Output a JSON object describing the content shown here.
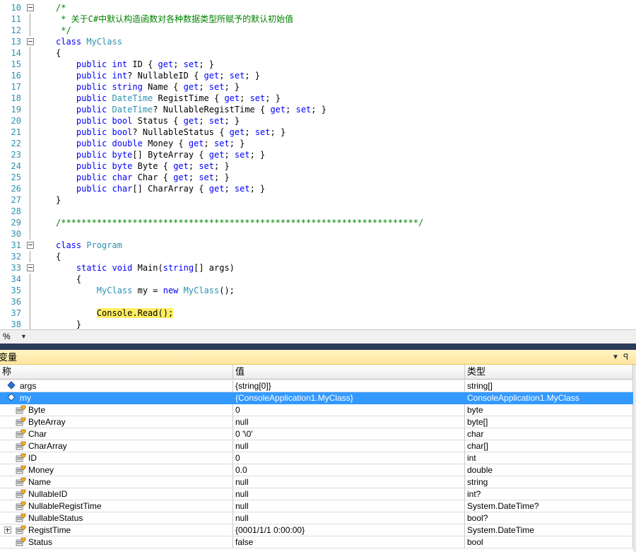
{
  "editor": {
    "lines": [
      {
        "num": "10",
        "fold": "collapse",
        "tokens": [
          {
            "t": "/*",
            "c": "cm"
          }
        ]
      },
      {
        "num": "11",
        "fold": "line",
        "tokens": [
          {
            "t": " * 关于C#中默认构造函数对各种数据类型所赋予的默认初始值",
            "c": "cm"
          }
        ]
      },
      {
        "num": "12",
        "fold": "line",
        "tokens": [
          {
            "t": " */",
            "c": "cm"
          }
        ]
      },
      {
        "num": "13",
        "fold": "collapse",
        "tokens": [
          {
            "t": "class ",
            "c": "kw"
          },
          {
            "t": "MyClass",
            "c": "ty"
          }
        ]
      },
      {
        "num": "14",
        "fold": "line",
        "tokens": [
          {
            "t": "{",
            "c": ""
          }
        ]
      },
      {
        "num": "15",
        "fold": "line",
        "tokens": [
          {
            "t": "    ",
            "c": ""
          },
          {
            "t": "public int ",
            "c": "kw"
          },
          {
            "t": "ID { ",
            "c": ""
          },
          {
            "t": "get",
            "c": "kw"
          },
          {
            "t": "; ",
            "c": ""
          },
          {
            "t": "set",
            "c": "kw"
          },
          {
            "t": "; }",
            "c": ""
          }
        ]
      },
      {
        "num": "16",
        "fold": "line",
        "tokens": [
          {
            "t": "    ",
            "c": ""
          },
          {
            "t": "public int",
            "c": "kw"
          },
          {
            "t": "? NullableID { ",
            "c": ""
          },
          {
            "t": "get",
            "c": "kw"
          },
          {
            "t": "; ",
            "c": ""
          },
          {
            "t": "set",
            "c": "kw"
          },
          {
            "t": "; }",
            "c": ""
          }
        ]
      },
      {
        "num": "17",
        "fold": "line",
        "tokens": [
          {
            "t": "    ",
            "c": ""
          },
          {
            "t": "public string ",
            "c": "kw"
          },
          {
            "t": "Name { ",
            "c": ""
          },
          {
            "t": "get",
            "c": "kw"
          },
          {
            "t": "; ",
            "c": ""
          },
          {
            "t": "set",
            "c": "kw"
          },
          {
            "t": "; }",
            "c": ""
          }
        ]
      },
      {
        "num": "18",
        "fold": "line",
        "tokens": [
          {
            "t": "    ",
            "c": ""
          },
          {
            "t": "public ",
            "c": "kw"
          },
          {
            "t": "DateTime",
            "c": "ty"
          },
          {
            "t": " RegistTime { ",
            "c": ""
          },
          {
            "t": "get",
            "c": "kw"
          },
          {
            "t": "; ",
            "c": ""
          },
          {
            "t": "set",
            "c": "kw"
          },
          {
            "t": "; }",
            "c": ""
          }
        ]
      },
      {
        "num": "19",
        "fold": "line",
        "tokens": [
          {
            "t": "    ",
            "c": ""
          },
          {
            "t": "public ",
            "c": "kw"
          },
          {
            "t": "DateTime",
            "c": "ty"
          },
          {
            "t": "? NullableRegistTime { ",
            "c": ""
          },
          {
            "t": "get",
            "c": "kw"
          },
          {
            "t": "; ",
            "c": ""
          },
          {
            "t": "set",
            "c": "kw"
          },
          {
            "t": "; }",
            "c": ""
          }
        ]
      },
      {
        "num": "20",
        "fold": "line",
        "tokens": [
          {
            "t": "    ",
            "c": ""
          },
          {
            "t": "public bool ",
            "c": "kw"
          },
          {
            "t": "Status { ",
            "c": ""
          },
          {
            "t": "get",
            "c": "kw"
          },
          {
            "t": "; ",
            "c": ""
          },
          {
            "t": "set",
            "c": "kw"
          },
          {
            "t": "; }",
            "c": ""
          }
        ]
      },
      {
        "num": "21",
        "fold": "line",
        "tokens": [
          {
            "t": "    ",
            "c": ""
          },
          {
            "t": "public bool",
            "c": "kw"
          },
          {
            "t": "? NullableStatus { ",
            "c": ""
          },
          {
            "t": "get",
            "c": "kw"
          },
          {
            "t": "; ",
            "c": ""
          },
          {
            "t": "set",
            "c": "kw"
          },
          {
            "t": "; }",
            "c": ""
          }
        ]
      },
      {
        "num": "22",
        "fold": "line",
        "tokens": [
          {
            "t": "    ",
            "c": ""
          },
          {
            "t": "public double ",
            "c": "kw"
          },
          {
            "t": "Money { ",
            "c": ""
          },
          {
            "t": "get",
            "c": "kw"
          },
          {
            "t": "; ",
            "c": ""
          },
          {
            "t": "set",
            "c": "kw"
          },
          {
            "t": "; }",
            "c": ""
          }
        ]
      },
      {
        "num": "23",
        "fold": "line",
        "tokens": [
          {
            "t": "    ",
            "c": ""
          },
          {
            "t": "public byte",
            "c": "kw"
          },
          {
            "t": "[] ByteArray { ",
            "c": ""
          },
          {
            "t": "get",
            "c": "kw"
          },
          {
            "t": "; ",
            "c": ""
          },
          {
            "t": "set",
            "c": "kw"
          },
          {
            "t": "; }",
            "c": ""
          }
        ]
      },
      {
        "num": "24",
        "fold": "line",
        "tokens": [
          {
            "t": "    ",
            "c": ""
          },
          {
            "t": "public byte ",
            "c": "kw"
          },
          {
            "t": "Byte { ",
            "c": ""
          },
          {
            "t": "get",
            "c": "kw"
          },
          {
            "t": "; ",
            "c": ""
          },
          {
            "t": "set",
            "c": "kw"
          },
          {
            "t": "; }",
            "c": ""
          }
        ]
      },
      {
        "num": "25",
        "fold": "line",
        "tokens": [
          {
            "t": "    ",
            "c": ""
          },
          {
            "t": "public char ",
            "c": "kw"
          },
          {
            "t": "Char { ",
            "c": ""
          },
          {
            "t": "get",
            "c": "kw"
          },
          {
            "t": "; ",
            "c": ""
          },
          {
            "t": "set",
            "c": "kw"
          },
          {
            "t": "; }",
            "c": ""
          }
        ]
      },
      {
        "num": "26",
        "fold": "line",
        "tokens": [
          {
            "t": "    ",
            "c": ""
          },
          {
            "t": "public char",
            "c": "kw"
          },
          {
            "t": "[] CharArray { ",
            "c": ""
          },
          {
            "t": "get",
            "c": "kw"
          },
          {
            "t": "; ",
            "c": ""
          },
          {
            "t": "set",
            "c": "kw"
          },
          {
            "t": "; }",
            "c": ""
          }
        ]
      },
      {
        "num": "27",
        "fold": "line",
        "tokens": [
          {
            "t": "}",
            "c": ""
          }
        ]
      },
      {
        "num": "28",
        "fold": "line",
        "tokens": []
      },
      {
        "num": "29",
        "fold": "line",
        "tokens": [
          {
            "t": "/**********************************************************************/",
            "c": "cm"
          }
        ]
      },
      {
        "num": "30",
        "fold": "line",
        "tokens": []
      },
      {
        "num": "31",
        "fold": "collapse",
        "tokens": [
          {
            "t": "class ",
            "c": "kw"
          },
          {
            "t": "Program",
            "c": "ty"
          }
        ]
      },
      {
        "num": "32",
        "fold": "line",
        "tokens": [
          {
            "t": "{",
            "c": ""
          }
        ]
      },
      {
        "num": "33",
        "fold": "collapse",
        "tokens": [
          {
            "t": "    ",
            "c": ""
          },
          {
            "t": "static void ",
            "c": "kw"
          },
          {
            "t": "Main(",
            "c": ""
          },
          {
            "t": "string",
            "c": "kw"
          },
          {
            "t": "[] args)",
            "c": ""
          }
        ]
      },
      {
        "num": "34",
        "fold": "line",
        "tokens": [
          {
            "t": "    {",
            "c": ""
          }
        ]
      },
      {
        "num": "35",
        "fold": "line",
        "tokens": [
          {
            "t": "        ",
            "c": ""
          },
          {
            "t": "MyClass",
            "c": "ty"
          },
          {
            "t": " my = ",
            "c": ""
          },
          {
            "t": "new ",
            "c": "kw"
          },
          {
            "t": "MyClass",
            "c": "ty"
          },
          {
            "t": "();",
            "c": ""
          }
        ]
      },
      {
        "num": "36",
        "fold": "line",
        "tokens": []
      },
      {
        "num": "37",
        "fold": "line",
        "tokens": [
          {
            "t": "        ",
            "c": ""
          },
          {
            "t": "Console.Read();",
            "c": "hl"
          }
        ]
      },
      {
        "num": "38",
        "fold": "line",
        "tokens": [
          {
            "t": "    }",
            "c": ""
          }
        ]
      }
    ]
  },
  "zoom": {
    "label": "%",
    "arrow": "▼"
  },
  "locals": {
    "title": "变量",
    "pin_glyph": "ꟼ",
    "columns": [
      "称",
      "值",
      "类型"
    ],
    "rows": [
      {
        "level": 0,
        "icon": "field-icon",
        "expander": false,
        "name": "args",
        "value": "{string[0]}",
        "type": "string[]",
        "selected": false
      },
      {
        "level": 0,
        "icon": "field-icon",
        "expander": false,
        "name": "my",
        "value": "{ConsoleApplication1.MyClass}",
        "type": "ConsoleApplication1.MyClass",
        "selected": true
      },
      {
        "level": 1,
        "icon": "property-icon",
        "expander": false,
        "name": "Byte",
        "value": "0",
        "type": "byte",
        "selected": false
      },
      {
        "level": 1,
        "icon": "property-icon",
        "expander": false,
        "name": "ByteArray",
        "value": "null",
        "type": "byte[]",
        "selected": false
      },
      {
        "level": 1,
        "icon": "property-icon",
        "expander": false,
        "name": "Char",
        "value": "0 '\\0'",
        "type": "char",
        "selected": false
      },
      {
        "level": 1,
        "icon": "property-icon",
        "expander": false,
        "name": "CharArray",
        "value": "null",
        "type": "char[]",
        "selected": false
      },
      {
        "level": 1,
        "icon": "property-icon",
        "expander": false,
        "name": "ID",
        "value": "0",
        "type": "int",
        "selected": false
      },
      {
        "level": 1,
        "icon": "property-icon",
        "expander": false,
        "name": "Money",
        "value": "0.0",
        "type": "double",
        "selected": false
      },
      {
        "level": 1,
        "icon": "property-icon",
        "expander": false,
        "name": "Name",
        "value": "null",
        "type": "string",
        "selected": false
      },
      {
        "level": 1,
        "icon": "property-icon",
        "expander": false,
        "name": "NullableID",
        "value": "null",
        "type": "int?",
        "selected": false
      },
      {
        "level": 1,
        "icon": "property-icon",
        "expander": false,
        "name": "NullableRegistTime",
        "value": "null",
        "type": "System.DateTime?",
        "selected": false
      },
      {
        "level": 1,
        "icon": "property-icon",
        "expander": false,
        "name": "NullableStatus",
        "value": "null",
        "type": "bool?",
        "selected": false
      },
      {
        "level": 1,
        "icon": "property-icon",
        "expander": true,
        "name": "RegistTime",
        "value": "{0001/1/1 0:00:00}",
        "type": "System.DateTime",
        "selected": false
      },
      {
        "level": 1,
        "icon": "property-icon",
        "expander": false,
        "name": "Status",
        "value": "false",
        "type": "bool",
        "selected": false
      }
    ]
  },
  "colors": {
    "keyword": "#0000ff",
    "type": "#2b91af",
    "comment": "#008000",
    "highlight": "#ffee62",
    "selection": "#3399ff"
  }
}
